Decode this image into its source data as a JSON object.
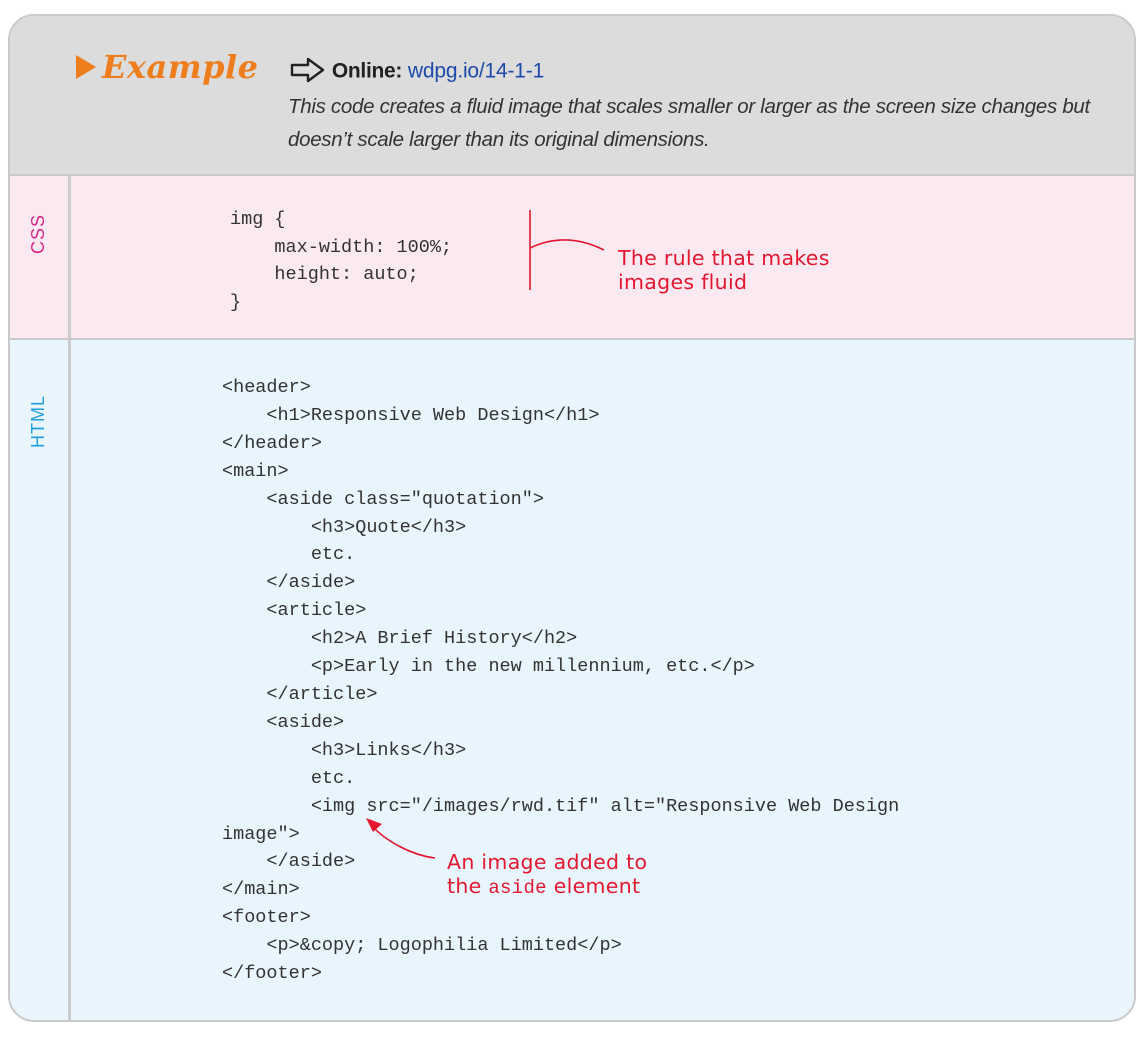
{
  "example": {
    "title": "Example",
    "online_label": "Online:",
    "online_url": "wdpg.io/14-1-1",
    "description": "This code creates a fluid image that scales smaller or larger as the screen size changes but doesn’t scale larger than its original dimensions."
  },
  "css_section": {
    "label": "CSS",
    "code": "img {\n    max-width: 100%;\n    height: auto;\n}",
    "annotation": "The rule that makes\nimages fluid"
  },
  "html_section": {
    "label": "HTML",
    "code": "<header>\n    <h1>Responsive Web Design</h1>\n</header>\n<main>\n    <aside class=\"quotation\">\n        <h3>Quote</h3>\n        etc.\n    </aside>\n    <article>\n        <h2>A Brief History</h2>\n        <p>Early in the new millennium, etc.</p>\n    </article>\n    <aside>\n        <h3>Links</h3>\n        etc.\n        <img src=\"/images/rwd.tif\" alt=\"Responsive Web Design\nimage\">\n    </aside>\n</main>\n<footer>\n    <p>&copy; Logophilia Limited</p>\n</footer>",
    "annotation_line1": "An image added to",
    "annotation_prefix": "the ",
    "annotation_code": "aside",
    "annotation_suffix": " element"
  },
  "colors": {
    "accent": "#ee7d1e",
    "link": "#1b4aa8",
    "css_bg": "#fbe9f1",
    "html_bg": "#e8f5fc",
    "annotation": "#e3172f"
  },
  "icons": [
    "play-arrow-icon",
    "right-arrow-outline-icon"
  ]
}
